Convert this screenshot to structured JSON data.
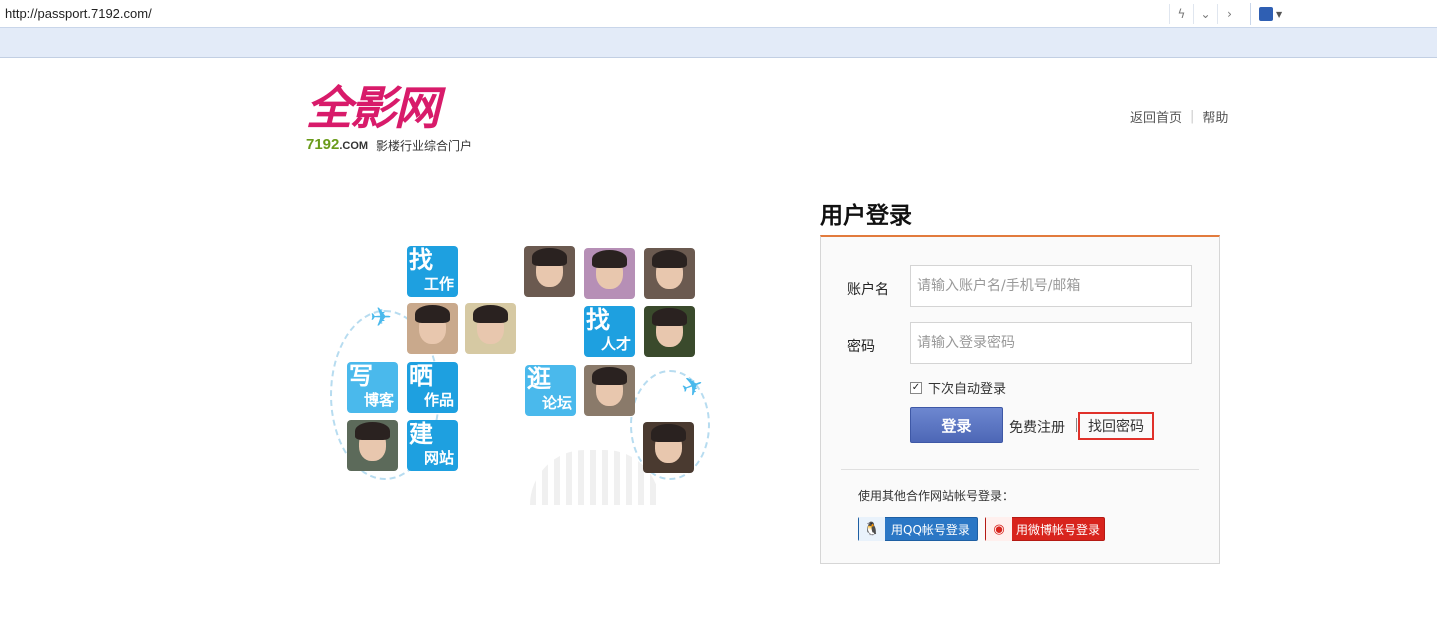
{
  "browser": {
    "url": "http://passport.7192.com/"
  },
  "header": {
    "logo_text": "全影网",
    "logo_domain": "7192",
    "logo_domain_suffix": ".COM",
    "logo_tagline": "影楼行业综合门户",
    "links": [
      "返回首页",
      "帮助"
    ]
  },
  "collage": {
    "tiles": [
      {
        "big": "找",
        "small": "工作"
      },
      {
        "big": "找",
        "small": "人才"
      },
      {
        "big": "写",
        "small": "博客"
      },
      {
        "big": "晒",
        "small": "作品"
      },
      {
        "big": "逛",
        "small": "论坛"
      },
      {
        "big": "建",
        "small": "网站"
      }
    ]
  },
  "login": {
    "title": "用户登录",
    "account_label": "账户名",
    "account_placeholder": "请输入账户名/手机号/邮箱",
    "password_label": "密码",
    "password_placeholder": "请输入登录密码",
    "remember_label": "下次自动登录",
    "remember_checked": true,
    "submit_label": "登录",
    "register_link": "免费注册",
    "forgot_link": "找回密码",
    "other_login_text": "使用其他合作网站帐号登录：",
    "qq_login": "用QQ帐号登录",
    "weibo_login": "用微博帐号登录"
  },
  "colors": {
    "brand": "#d81b6a",
    "panel_accent": "#e27b3d",
    "login_button": "#5a74c2",
    "highlight_box": "#e0312a"
  }
}
